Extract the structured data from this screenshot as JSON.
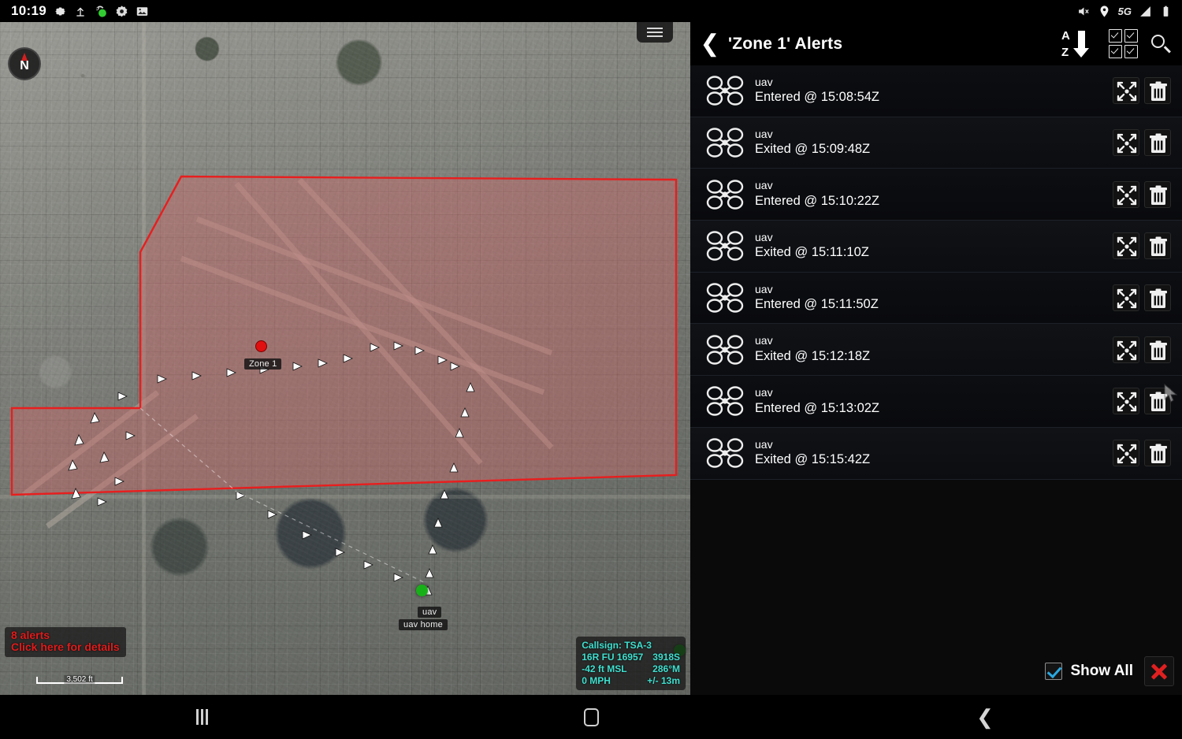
{
  "status_bar": {
    "clock": "10:19",
    "left_icons": [
      "gear-icon",
      "upload-icon",
      "sync-globe-icon",
      "settings-flower-icon",
      "image-icon"
    ],
    "right_icons": [
      "mute-icon",
      "location-pin-icon",
      "signal-bars-icon",
      "battery-icon"
    ],
    "network_label": "5G"
  },
  "map": {
    "compass_label": "N",
    "menu_icon": "hamburger-menu-icon",
    "zone_label": "Zone 1",
    "zone_fill_color": "#c96a6a",
    "zone_outline_color": "#e81e1e",
    "uav_label": "uav",
    "uav_home_label": "uav home",
    "alert_banner": {
      "line1": "8 alerts",
      "line2": "Click here for details",
      "color": "#e01c1c"
    },
    "scale_bar_label": "3,502 ft",
    "info_box": {
      "color": "#3fe0d0",
      "callsign": "Callsign: TSA-3",
      "grid_left": "16R  FU  16957",
      "grid_right": "3918S",
      "altitude": "-42 ft MSL",
      "heading": "286°M",
      "speed": "0 MPH",
      "accuracy": "+/- 13m"
    }
  },
  "panel": {
    "back_icon": "back-chevron-icon",
    "title": "'Zone 1' Alerts",
    "tools": {
      "sort_az": {
        "top": "A",
        "bottom": "Z",
        "icon": "sort-az-descending-icon"
      },
      "multi_select_icon": "checkbox-grid-icon",
      "search_icon": "search-icon"
    },
    "rows": [
      {
        "icon": "quadcopter-icon",
        "title": "uav",
        "subtitle": "Entered @ 15:08:54Z",
        "focus_icon": "zoom-to-icon",
        "delete_icon": "trash-icon"
      },
      {
        "icon": "quadcopter-icon",
        "title": "uav",
        "subtitle": "Exited @ 15:09:48Z",
        "focus_icon": "zoom-to-icon",
        "delete_icon": "trash-icon"
      },
      {
        "icon": "quadcopter-icon",
        "title": "uav",
        "subtitle": "Entered @ 15:10:22Z",
        "focus_icon": "zoom-to-icon",
        "delete_icon": "trash-icon"
      },
      {
        "icon": "quadcopter-icon",
        "title": "uav",
        "subtitle": "Exited @ 15:11:10Z",
        "focus_icon": "zoom-to-icon",
        "delete_icon": "trash-icon"
      },
      {
        "icon": "quadcopter-icon",
        "title": "uav",
        "subtitle": "Entered @ 15:11:50Z",
        "focus_icon": "zoom-to-icon",
        "delete_icon": "trash-icon"
      },
      {
        "icon": "quadcopter-icon",
        "title": "uav",
        "subtitle": "Exited @ 15:12:18Z",
        "focus_icon": "zoom-to-icon",
        "delete_icon": "trash-icon"
      },
      {
        "icon": "quadcopter-icon",
        "title": "uav",
        "subtitle": "Entered @ 15:13:02Z",
        "focus_icon": "zoom-to-icon",
        "delete_icon": "trash-icon"
      },
      {
        "icon": "quadcopter-icon",
        "title": "uav",
        "subtitle": "Exited @ 15:15:42Z",
        "focus_icon": "zoom-to-icon",
        "delete_icon": "trash-icon"
      }
    ],
    "footer": {
      "show_all_label": "Show All",
      "show_all_checked": true,
      "check_color": "#2aa8e0",
      "close_icon": "close-x-icon",
      "close_color": "#e02020"
    }
  },
  "nav_bar": {
    "recents_icon": "recents-icon",
    "home_icon": "home-icon",
    "back_icon": "back-icon"
  }
}
